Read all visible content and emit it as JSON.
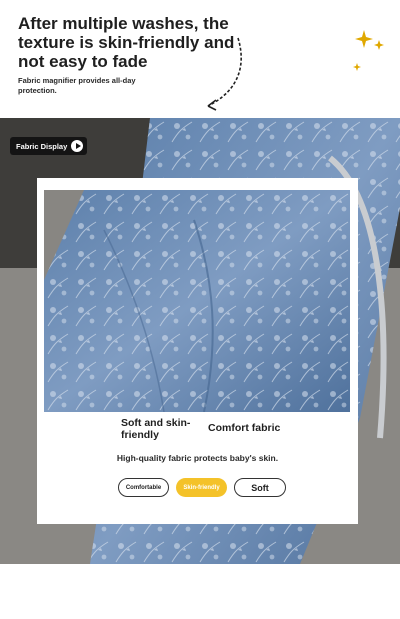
{
  "header": {
    "headline": "After multiple washes, the texture is skin-friendly and not easy to fade",
    "subline": "Fabric magnifier provides all-day protection."
  },
  "badge": {
    "label": "Fabric Display",
    "icon": "play-icon"
  },
  "card": {
    "feature_a": "Soft and skin-friendly",
    "feature_b": "Comfort fabric",
    "tagline": "High-quality fabric protects baby's skin.",
    "pills": [
      "Comfortable",
      "Skin-friendly",
      "Soft"
    ]
  },
  "colors": {
    "accent_pill": "#f4c229",
    "denim": "#6f8fb5",
    "badge_bg": "#141414"
  }
}
